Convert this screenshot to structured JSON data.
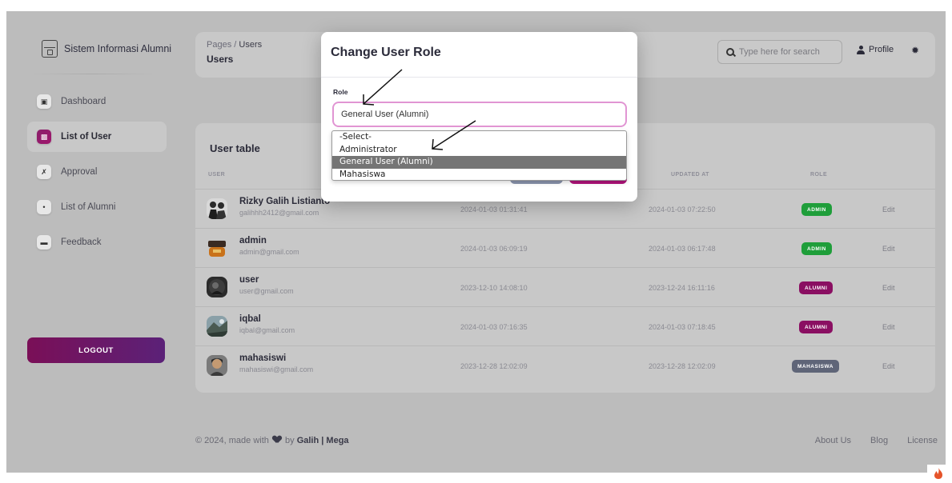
{
  "sidebar": {
    "brand": "Sistem Informasi Alumni",
    "items": [
      {
        "label": "Dashboard",
        "icon": "shop-icon"
      },
      {
        "label": "List of User",
        "icon": "chart-icon"
      },
      {
        "label": "Approval",
        "icon": "tools-icon"
      },
      {
        "label": "List of Alumni",
        "icon": "users-icon"
      },
      {
        "label": "Feedback",
        "icon": "card-icon"
      }
    ],
    "logout_label": "LOGOUT"
  },
  "header": {
    "breadcrumb_root": "Pages",
    "breadcrumb_sep": "/",
    "breadcrumb_current": "Users",
    "title": "Users",
    "search_placeholder": "Type here for search",
    "profile_label": "Profile"
  },
  "table": {
    "title": "User table",
    "columns": [
      "USER",
      "UPDATED AT",
      "ROLE"
    ],
    "rows": [
      {
        "name": "Rizky Galih Listianto",
        "email": "galihhh2412@gmail.com",
        "created": "2024-01-03 01:31:41",
        "updated": "2024-01-03 07:22:50",
        "role": "ADMIN",
        "role_color": "#1f9e3a",
        "edit": "Edit"
      },
      {
        "name": "admin",
        "email": "admin@gmail.com",
        "created": "2024-01-03 06:09:19",
        "updated": "2024-01-03 06:17:48",
        "role": "ADMIN",
        "role_color": "#1f9e3a",
        "edit": "Edit"
      },
      {
        "name": "user",
        "email": "user@gmail.com",
        "created": "2023-12-10 14:08:10",
        "updated": "2023-12-24 16:11:16",
        "role": "ALUMNI",
        "role_color": "#8a0f62",
        "edit": "Edit"
      },
      {
        "name": "iqbal",
        "email": "iqbal@gmail.com",
        "created": "2024-01-03 07:16:35",
        "updated": "2024-01-03 07:18:45",
        "role": "ALUMNI",
        "role_color": "#8a0f62",
        "edit": "Edit"
      },
      {
        "name": "mahasiswi",
        "email": "mahasiswi@gmail.com",
        "created": "2023-12-28 12:02:09",
        "updated": "2023-12-28 12:02:09",
        "role": "MAHASISWA",
        "role_color": "#5f6578",
        "edit": "Edit"
      }
    ]
  },
  "footer": {
    "prefix": "© 2024, made with",
    "by": "by",
    "author1": "Galih",
    "sep": "|",
    "author2": "Mega",
    "links": [
      "About Us",
      "Blog",
      "License"
    ]
  },
  "modal": {
    "title": "Change User Role",
    "role_label": "Role",
    "selected_value": "General User (Alumni)",
    "options": [
      "-Select-",
      "Administrator",
      "General User (Alumni)",
      "Mahasiswa"
    ],
    "highlighted_option": "General User (Alumni)"
  }
}
